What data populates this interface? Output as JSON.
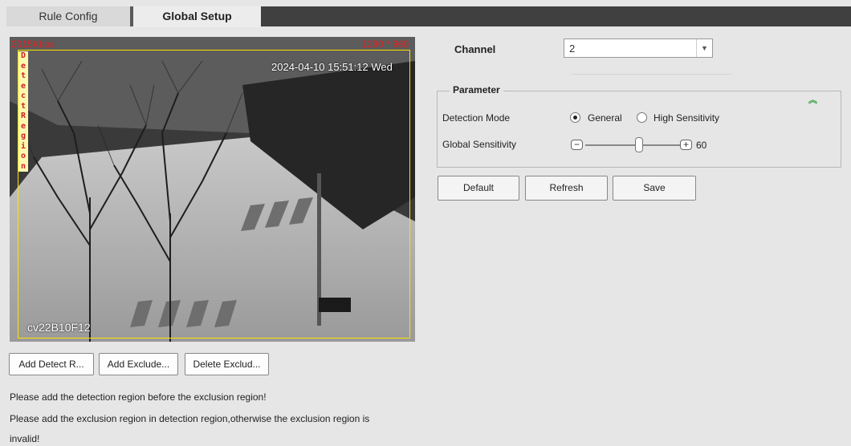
{
  "tabs": [
    {
      "label": "Rule Config",
      "active": false
    },
    {
      "label": "Global Setup",
      "active": true
    }
  ],
  "video": {
    "bitrate": "2015Kbps",
    "resolution": "1280 * 960",
    "timestamp": "2024-04-10 15:51:12 Wed",
    "camera_name": "cv22B10F12",
    "region_label": "Detect Region"
  },
  "region_buttons": {
    "add_detect": "Add Detect R...",
    "add_exclude": "Add Exclude...",
    "delete_exclude": "Delete Exclud..."
  },
  "notes": [
    "Please add the detection region before the exclusion region!",
    "Please add the exclusion region in detection region,otherwise the exclusion region is",
    "invalid!"
  ],
  "channel": {
    "label": "Channel",
    "value": "2"
  },
  "parameter": {
    "title": "Parameter",
    "detection_mode_label": "Detection Mode",
    "mode_general": "General",
    "mode_high": "High Sensitivity",
    "selected_mode": "General",
    "global_sensitivity_label": "Global Sensitivity",
    "sensitivity_value": "60"
  },
  "actions": {
    "default": "Default",
    "refresh": "Refresh",
    "save": "Save"
  },
  "colors": {
    "overlay_text": "#e02020",
    "region_border": "#ffe000",
    "collapse_icon": "#3aa24a"
  }
}
